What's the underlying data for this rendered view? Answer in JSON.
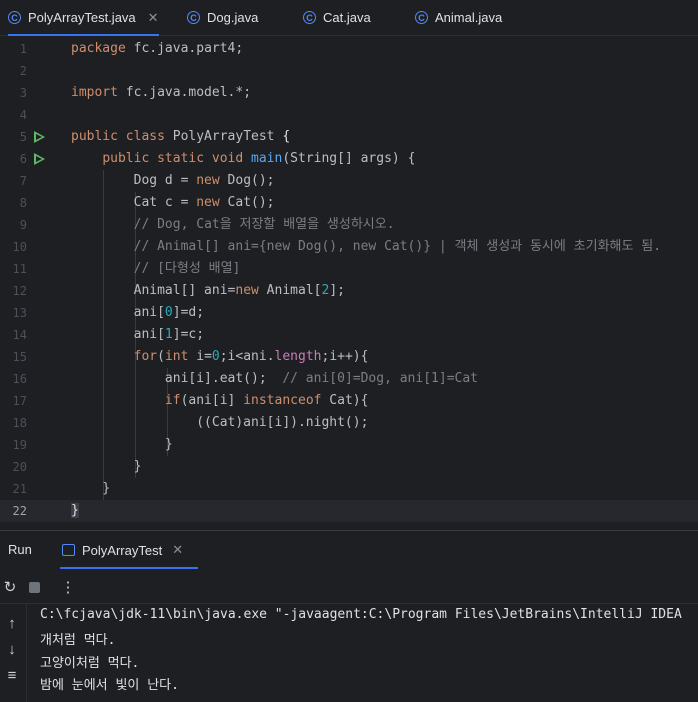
{
  "tabs": [
    {
      "label": "PolyArrayTest.java",
      "active": true,
      "icon": "class-icon"
    },
    {
      "label": "Dog.java",
      "active": false,
      "icon": "class-icon"
    },
    {
      "label": "Cat.java",
      "active": false,
      "icon": "class-icon"
    },
    {
      "label": "Animal.java",
      "active": false,
      "icon": "class-icon"
    }
  ],
  "editor": {
    "line_numbers": [
      "1",
      "2",
      "3",
      "4",
      "5",
      "6",
      "7",
      "8",
      "9",
      "10",
      "11",
      "12",
      "13",
      "14",
      "15",
      "16",
      "17",
      "18",
      "19",
      "20",
      "21",
      "22"
    ],
    "current_line": "22"
  },
  "run_panel": {
    "label": "Run",
    "tab_label": "PolyArrayTest",
    "output": [
      "C:\\fcjava\\jdk-11\\bin\\java.exe \"-javaagent:C:\\Program Files\\JetBrains\\IntelliJ IDEA",
      "개처럼 먹다.",
      "고양이처럼 먹다.",
      "밤에 눈에서 빛이 난다."
    ]
  },
  "colors": {
    "keyword": "#cf8e6d",
    "function": "#56a8f5",
    "number": "#2aacb8",
    "comment": "#7a7e85",
    "accent": "#3574f0",
    "run": "#5fb865"
  }
}
